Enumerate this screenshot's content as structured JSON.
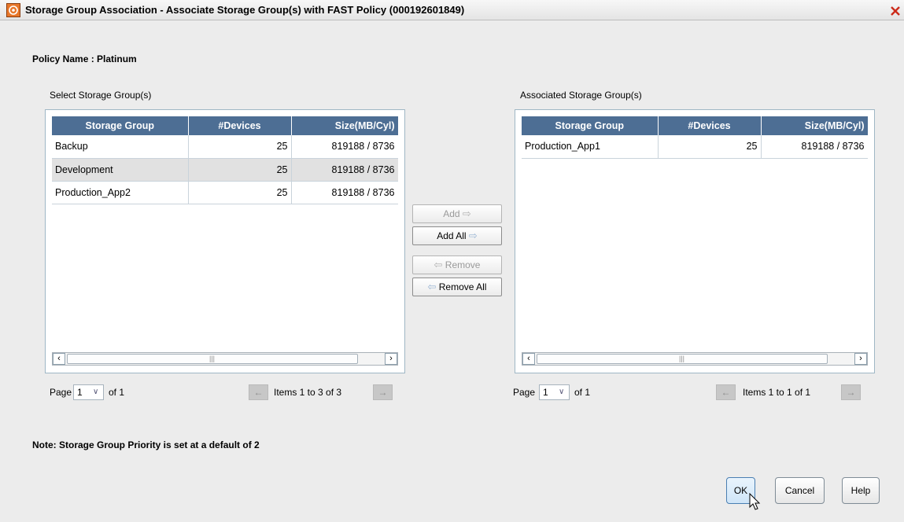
{
  "window": {
    "title": "Storage Group Association - Associate Storage Group(s) with FAST Policy (000192601849)"
  },
  "policy_label": "Policy Name : Platinum",
  "left_pane": {
    "label": "Select Storage Group(s)",
    "columns": [
      "Storage Group",
      "#Devices",
      "Size(MB/Cyl)"
    ],
    "rows": [
      {
        "name": "Backup",
        "devices": "25",
        "size": "819188 / 8736"
      },
      {
        "name": "Development",
        "devices": "25",
        "size": "819188 / 8736"
      },
      {
        "name": "Production_App2",
        "devices": "25",
        "size": "819188 / 8736"
      }
    ],
    "pager": {
      "prefix": "Page",
      "page": "1",
      "of": "of 1",
      "items": "Items 1 to 3 of 3"
    }
  },
  "right_pane": {
    "label": "Associated Storage Group(s)",
    "columns": [
      "Storage Group",
      "#Devices",
      "Size(MB/Cyl)"
    ],
    "rows": [
      {
        "name": "Production_App1",
        "devices": "25",
        "size": "819188 / 8736"
      }
    ],
    "pager": {
      "prefix": "Page",
      "page": "1",
      "of": "of 1",
      "items": "Items 1 to 1 of 1"
    }
  },
  "transfer_buttons": {
    "add": "Add",
    "add_all": "Add All",
    "remove": "Remove",
    "remove_all": "Remove All"
  },
  "note": "Note: Storage Group Priority is set at a default of 2",
  "footer": {
    "ok": "OK",
    "cancel": "Cancel",
    "help": "Help"
  },
  "colors": {
    "header_bg": "#4d6e94",
    "border": "#9fb7c5",
    "close": "#cc2b1a",
    "selected_row": "#e1e1e1"
  },
  "icons": [
    "app-icon",
    "close-icon",
    "right-arrow-icon",
    "left-arrow-icon",
    "scroll-left-icon",
    "scroll-right-icon",
    "chevron-down-icon",
    "prev-page-icon",
    "next-page-icon"
  ]
}
